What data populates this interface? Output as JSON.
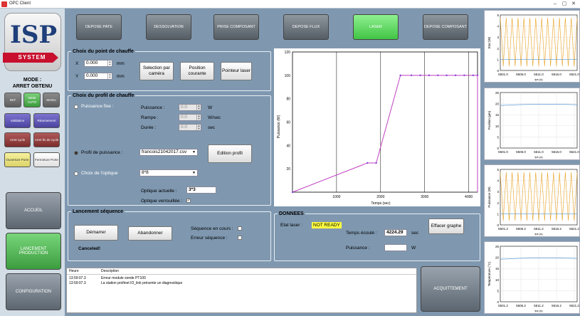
{
  "window": {
    "title": "OPC Client",
    "min": "–",
    "max": "▢",
    "close": "✕"
  },
  "logo": {
    "main": "ISP",
    "sub": "SYSTEM"
  },
  "mode": {
    "label": "MODE :",
    "value": "ARRET OBTENU"
  },
  "left_buttons": {
    "init": "INIT",
    "semi_auto": "SEMI AUTO",
    "manu": "MANU",
    "validation": "Validation",
    "rearmement": "Réarmement",
    "arret_cycle": "Arret cycle",
    "arret_fin_cycle": "Arret fin de cycle",
    "ouverture_porte": "Ouverture Porte",
    "fermeture_porte": "Fermeture Porte"
  },
  "nav": {
    "accueil": "ACCUEIL",
    "lancement": "LANCEMENT PRODUCTION",
    "configuration": "CONFIGURATION"
  },
  "top_buttons": [
    {
      "label": "DEPOSE PATE",
      "active": false
    },
    {
      "label": "DESSOLVATION",
      "active": false
    },
    {
      "label": "PRISE COMPOSANT",
      "active": false
    },
    {
      "label": "DEPOSE FLUX",
      "active": false
    },
    {
      "label": "LASER",
      "active": true
    },
    {
      "label": "DEPOSE COMPOSANT",
      "active": false
    }
  ],
  "point": {
    "title": "Choix du point de chauffe",
    "x_label": "X",
    "x_value": "0.000",
    "x_unit": "mm",
    "y_label": "Y",
    "y_value": "0.000",
    "y_unit": "mm",
    "btn_camera": "Selection par caméra",
    "btn_position": "Position courante",
    "btn_laser": "Pointeur laser"
  },
  "profil": {
    "title": "Choix du profil de chauffe",
    "puissance_fixe": "Puissance fixe :",
    "puissance_label": "Puissance :",
    "puissance_value": "0.0",
    "puissance_unit": "W",
    "rampe_label": "Rampe :",
    "rampe_value": "0.0",
    "rampe_unit": "W/sec",
    "duree_label": "Durée :",
    "duree_value": "0.0",
    "duree_unit": "sec",
    "profil_label": "Profil de puissance :",
    "profil_value": "francois21042017.csv",
    "btn_edition": "Edition profil",
    "optique_label": "Choix de l'optique",
    "optique_value": "8*8",
    "optique_actuelle_label": "Optique actuelle :",
    "optique_actuelle_value": "3*3",
    "optique_verrouillee_label": "Optique verrouillée :",
    "optique_verrouillee_mark": "✓"
  },
  "sequence": {
    "title": "Lancement séquence",
    "btn_demarrer": "Démarrer",
    "btn_abandonner": "Abandonner",
    "en_cours_label": "Séquence en cours :",
    "erreur_label": "Erreur séquence :",
    "status": "Canceled!"
  },
  "donnees": {
    "title": "DONNEES",
    "etat_label": "Etat laser :",
    "etat_value": "NOT READY",
    "temps_label": "Temps écoulé :",
    "temps_value": "4224.29",
    "temps_unit": "sec",
    "puissance_label": "Puissance :",
    "puissance_value": "",
    "puissance_unit": "W",
    "btn_effacer": "Effacer graphe"
  },
  "log": {
    "col_heure": "Heure",
    "col_description": "Description",
    "rows": [
      {
        "heure": "13:59:07.3",
        "description": "Erreur module sonde PT100"
      },
      {
        "heure": "13:59:07.3",
        "description": "La station profinet IO_link présente un diagnostique"
      }
    ]
  },
  "ack_button": "ACQUITTEMENT",
  "chart_data": {
    "type": "line",
    "title": "",
    "xlabel": "Temps (sec)",
    "ylabel": "Puissance (W)",
    "xlim": [
      0,
      4200
    ],
    "ylim": [
      0,
      120
    ],
    "x_ticks": [
      1000,
      2000,
      3000,
      4000
    ],
    "y_ticks": [
      20,
      40,
      60,
      80,
      100,
      120
    ],
    "series": [
      {
        "name": "",
        "color": "#c040c0",
        "x": [
          0,
          1700,
          1900,
          2450,
          2700,
          2900,
          3100,
          3300,
          3500,
          3700,
          3900,
          4100,
          4200
        ],
        "y": [
          0,
          25,
          25,
          100,
          100,
          100,
          100,
          100,
          100,
          100,
          100,
          100,
          100
        ]
      }
    ]
  },
  "mini_charts": [
    {
      "ylabel": "Etat (W)",
      "xlabel": "tps (s)",
      "ticks_x": [
        "5501.0",
        "5506.0",
        "5511.0",
        "5516.0",
        "5521.0"
      ],
      "ticks_y": [
        "0",
        "1",
        "2",
        "3",
        "4",
        "5"
      ],
      "kind": "osc"
    },
    {
      "ylabel": "Position (µm)",
      "xlabel": "tps (s)",
      "ticks_x": [
        "5501.0",
        "5506.0",
        "5511.0",
        "5516.0",
        "5521.0"
      ],
      "ticks_y": [
        "0",
        "5",
        "10",
        "15",
        "20",
        "25"
      ],
      "kind": "flat"
    },
    {
      "ylabel": "Puissance (W)",
      "xlabel": "tps (s)",
      "ticks_x": [
        "5501.2",
        "5506.2",
        "5511.2",
        "5516.2",
        "5521.2"
      ],
      "ticks_y": [
        "0",
        "1",
        "2",
        "3",
        "4",
        "5"
      ],
      "kind": "osc"
    },
    {
      "ylabel": "Température (°C)",
      "xlabel": "tps (s)",
      "ticks_x": [
        "5501.2",
        "5506.2",
        "5511.2",
        "5516.2",
        "5521.2"
      ],
      "ticks_y": [
        "0",
        "5",
        "10",
        "15",
        "20",
        "25"
      ],
      "kind": "flat"
    }
  ],
  "colors": {
    "accent_green": "#41c445",
    "panel": "#7f98b0",
    "plot_line": "#c040c0",
    "mini_line": "#e8a020"
  }
}
